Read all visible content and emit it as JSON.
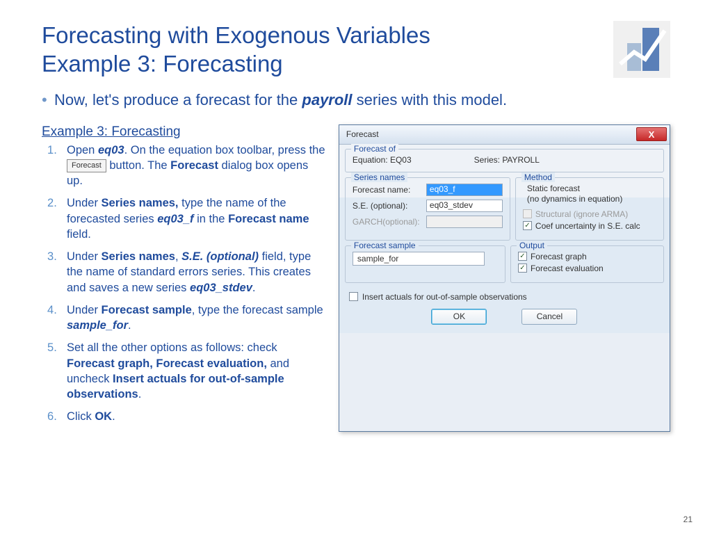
{
  "title_line1": "Forecasting with Exogenous Variables",
  "title_line2": "Example 3: Forecasting",
  "intro_pre": "Now, let's produce a forecast for the ",
  "intro_em": "payroll",
  "intro_post": " series with this model.",
  "example_heading": "Example 3: Forecasting",
  "steps": {
    "s1a": "Open ",
    "s1b": "eq03",
    "s1c": ". On the equation box toolbar, press the ",
    "s1btn": "Forecast",
    "s1d": " button. The ",
    "s1e": "Forecast",
    "s1f": " dialog box opens up.",
    "s2a": "Under ",
    "s2b": "Series names,",
    "s2c": " type the name of the forecasted series ",
    "s2d": "eq03_f",
    "s2e": " in the ",
    "s2f": "Forecast name",
    "s2g": " field.",
    "s3a": "Under ",
    "s3b": "Series names",
    "s3c": ", ",
    "s3d": "S.E. (optional)",
    "s3e": " field, type the name of standard errors series. This creates and saves a new series ",
    "s3f": "eq03_stdev",
    "s3g": ".",
    "s4a": "Under ",
    "s4b": "Forecast sample",
    "s4c": ", type the forecast sample ",
    "s4d": "sample_for",
    "s4e": ".",
    "s5a": "Set all the other options as follows: check ",
    "s5b": "Forecast graph, Forecast evaluation,",
    "s5c": " and uncheck ",
    "s5d": "Insert actuals for out-of-sample observations",
    "s5e": ".",
    "s6a": "Click ",
    "s6b": "OK",
    "s6c": "."
  },
  "dialog": {
    "title": "Forecast",
    "close_x": "X",
    "forecast_of": {
      "legend": "Forecast of",
      "eq_label": "Equation: EQ03",
      "series_label": "Series: PAYROLL"
    },
    "series_names": {
      "legend": "Series names",
      "fn_label": "Forecast name:",
      "fn_value": "eq03_f",
      "se_label": "S.E. (optional):",
      "se_value": "eq03_stdev",
      "garch_label": "GARCH(optional):",
      "garch_value": ""
    },
    "method": {
      "legend": "Method",
      "static1": "Static forecast",
      "static2": "(no dynamics in equation)",
      "structural": "Structural (ignore ARMA)",
      "coef": "Coef uncertainty in S.E. calc"
    },
    "forecast_sample": {
      "legend": "Forecast sample",
      "value": "sample_for"
    },
    "output": {
      "legend": "Output",
      "graph": "Forecast graph",
      "eval": "Forecast evaluation"
    },
    "insert_actuals": "Insert actuals for out-of-sample observations",
    "ok": "OK",
    "cancel": "Cancel",
    "check": "✓"
  },
  "page_number": "21"
}
